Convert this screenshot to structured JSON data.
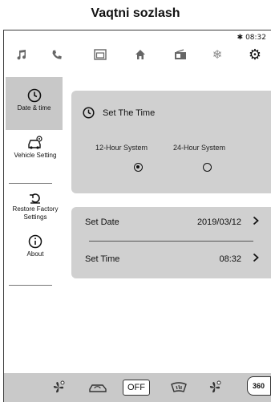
{
  "caption": "Vaqtni sozlash",
  "status": {
    "bluetooth_icon": "bluetooth-icon",
    "time": "08:32"
  },
  "topbar": {
    "icons": [
      "music-icon",
      "phone-icon",
      "apps-icon",
      "home-icon",
      "radio-icon",
      "climate-icon",
      "settings-icon"
    ]
  },
  "sidebar": {
    "items": [
      {
        "label": "Date & time",
        "icon": "clock-icon",
        "active": true
      },
      {
        "label": "Vehicle Setting",
        "icon": "car-settings-icon",
        "active": false
      },
      {
        "label": "Restore Factory Settings",
        "icon": "restore-icon",
        "active": false
      },
      {
        "label": "About",
        "icon": "info-icon",
        "active": false
      }
    ]
  },
  "time_panel": {
    "title": "Set The Time",
    "options": [
      {
        "label": "12-Hour System",
        "selected": true
      },
      {
        "label": "24-Hour System",
        "selected": false
      }
    ]
  },
  "date_panel": {
    "rows": [
      {
        "label": "Set Date",
        "value": "2019/03/12"
      },
      {
        "label": "Set Time",
        "value": "08:32"
      }
    ]
  },
  "bottombar": {
    "off_label": "OFF",
    "btn360_label": "360",
    "icons": [
      "fan-icon",
      "car-recirculate-icon",
      "off-button",
      "windshield-heat-icon",
      "fan-auto-icon",
      "360-view-icon"
    ]
  },
  "colors": {
    "panel": "#d0d0d0",
    "active_tab": "#c8c8c8",
    "bottombar": "#c9c9c9"
  }
}
